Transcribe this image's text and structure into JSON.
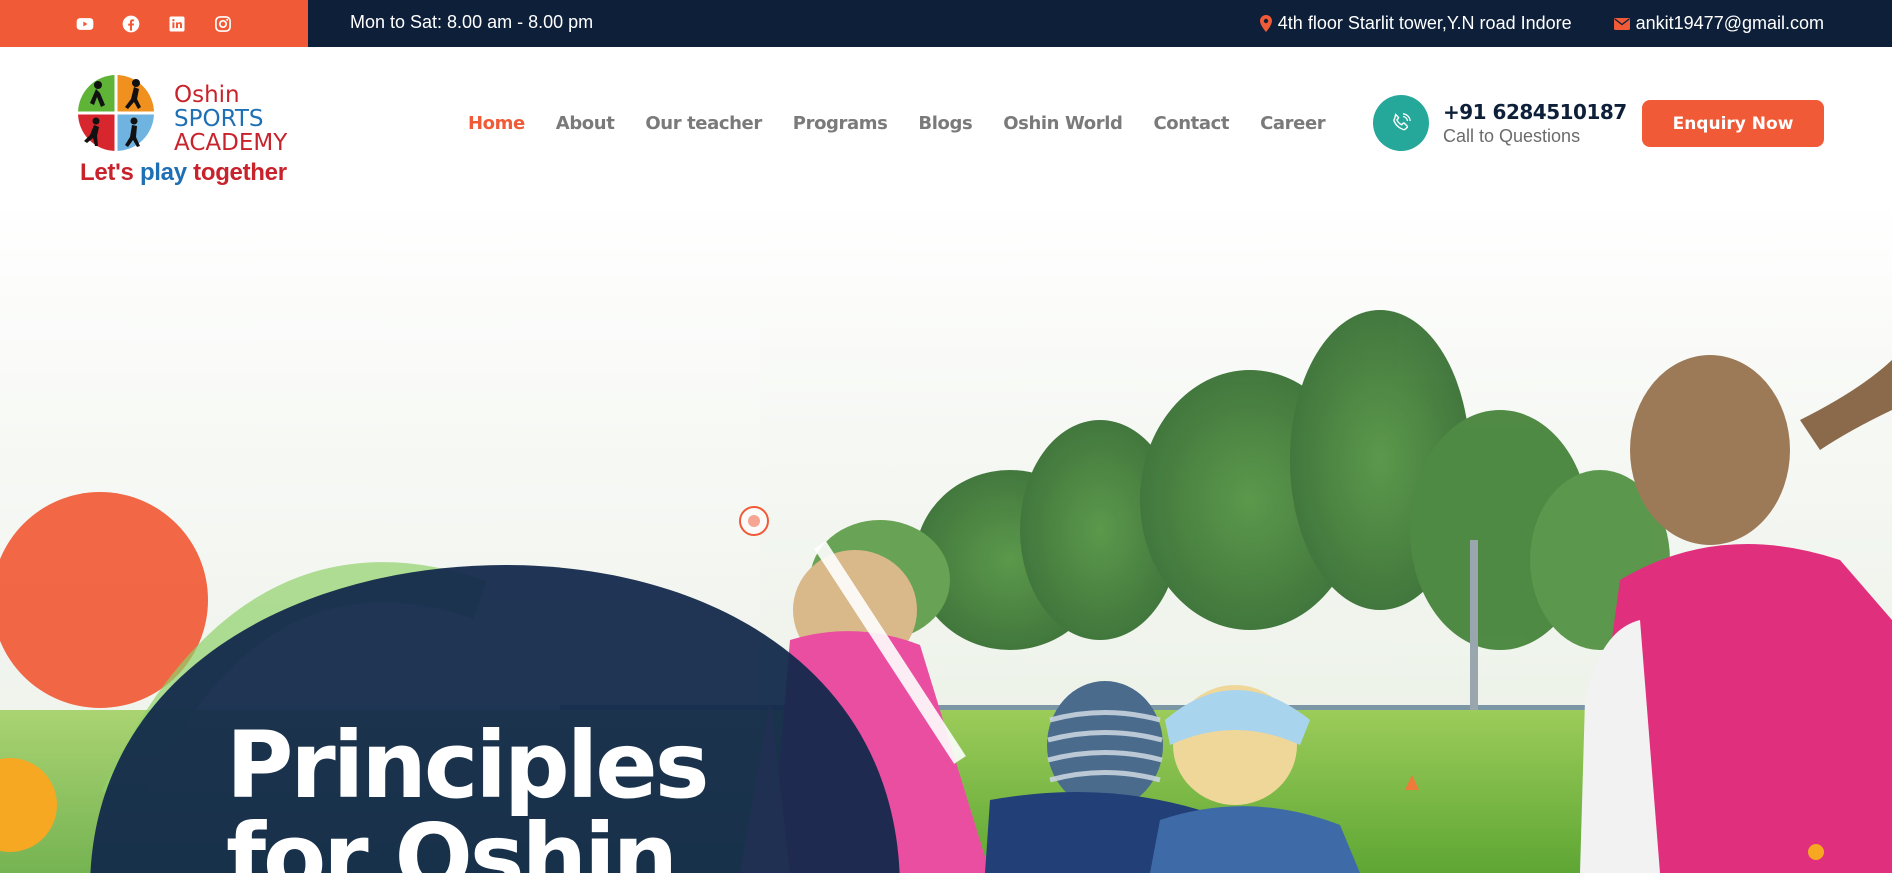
{
  "topbar": {
    "social": [
      {
        "name": "youtube-icon"
      },
      {
        "name": "facebook-icon"
      },
      {
        "name": "linkedin-icon"
      },
      {
        "name": "instagram-icon"
      }
    ],
    "hours": "Mon to Sat: 8.00 am - 8.00 pm",
    "address": "4th floor Starlit tower,Y.N road Indore",
    "email": "ankit19477@gmail.com"
  },
  "logo": {
    "name_line1": "Oshin",
    "name_line2": "SPORTS",
    "name_line3": "ACADEMY",
    "tagline_a": "Let's ",
    "tagline_b": "play ",
    "tagline_c": "together"
  },
  "nav": {
    "items": [
      {
        "label": "Home",
        "active": true
      },
      {
        "label": "About"
      },
      {
        "label": "Our teacher"
      },
      {
        "label": "Programs"
      },
      {
        "label": "Blogs"
      },
      {
        "label": "Oshin World"
      },
      {
        "label": "Contact"
      },
      {
        "label": "Career"
      }
    ]
  },
  "call": {
    "number": "+91 6284510187",
    "caption": "Call to Questions"
  },
  "enquiry": {
    "label": "Enquiry Now"
  },
  "hero": {
    "title_line1": "Principles",
    "title_line2": "for Oshin"
  },
  "colors": {
    "accent": "#f15a36",
    "navy": "#0e1f3a",
    "teal": "#25a89a",
    "green_arc": "#8fd16a",
    "orange_dot": "#f7a823"
  }
}
